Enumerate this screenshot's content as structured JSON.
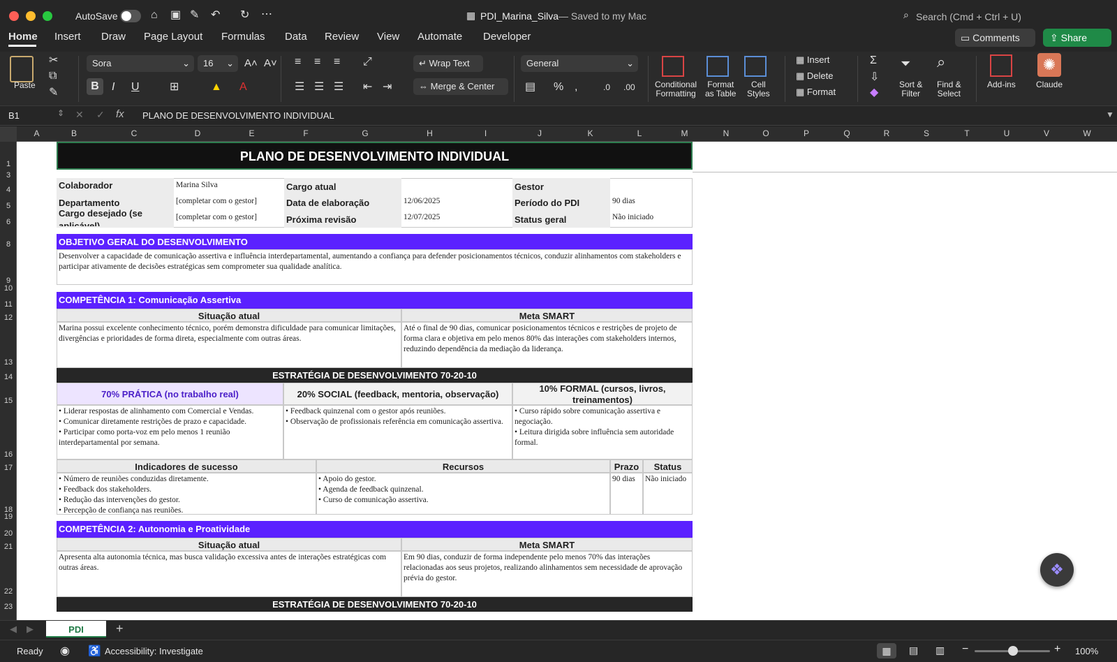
{
  "titlebar": {
    "autosave": "AutoSave",
    "doc_title": "PDI_Marina_Silva",
    "saved_status": "— Saved to my Mac",
    "search_placeholder": "Search (Cmd + Ctrl + U)"
  },
  "tabs": [
    "Home",
    "Insert",
    "Draw",
    "Page Layout",
    "Formulas",
    "Data",
    "Review",
    "View",
    "Automate",
    "Developer"
  ],
  "header_buttons": {
    "comments": "Comments",
    "share": "Share"
  },
  "ribbon": {
    "paste": "Paste",
    "font_name": "Sora",
    "font_size": "16",
    "wrap_text": "Wrap Text",
    "merge_center": "Merge & Center",
    "number_format": "General",
    "conditional": "Conditional",
    "formatting": "Formatting",
    "format_as": "Format",
    "as_table": "as Table",
    "cell": "Cell",
    "styles": "Styles",
    "insert": "Insert",
    "delete": "Delete",
    "format": "Format",
    "sort": "Sort &",
    "filter": "Filter",
    "find": "Find &",
    "select": "Select",
    "addins": "Add-ins",
    "claude": "Claude"
  },
  "formula_bar": {
    "cell_ref": "B1",
    "content": "PLANO DE DESENVOLVIMENTO INDIVIDUAL"
  },
  "columns": [
    "A",
    "B",
    "C",
    "D",
    "E",
    "F",
    "G",
    "H",
    "I",
    "J",
    "K",
    "L",
    "M",
    "N",
    "O",
    "P",
    "Q",
    "R",
    "S",
    "T",
    "U",
    "V",
    "W"
  ],
  "rows": [
    "1",
    "3",
    "4",
    "5",
    "6",
    "8",
    "9",
    "10",
    "11",
    "12",
    "13",
    "14",
    "15",
    "16",
    "17",
    "18",
    "19",
    "20",
    "21",
    "22",
    "23"
  ],
  "sheet": {
    "title": "PLANO DE DESENVOLVIMENTO INDIVIDUAL",
    "info": {
      "colaborador_label": "Colaborador",
      "colaborador": "Marina Silva",
      "cargo_label": "Cargo atual",
      "gestor_label": "Gestor",
      "departamento_label": "Departamento",
      "departamento": "[completar com o gestor]",
      "data_label": "Data de elaboração",
      "data": "12/06/2025",
      "periodo_label": "Período do PDI",
      "periodo": "90 dias",
      "cargo_desejado_label": "Cargo desejado (se aplicável)",
      "cargo_desejado": "[completar com o gestor]",
      "revisao_label": "Próxima revisão",
      "revisao": "12/07/2025",
      "status_label": "Status geral",
      "status": "Não iniciado"
    },
    "objetivo_title": "OBJETIVO GERAL DO DESENVOLVIMENTO",
    "objetivo_text": "Desenvolver a capacidade de comunicação assertiva e influência interdepartamental, aumentando a confiança para defender posicionamentos técnicos, conduzir alinhamentos com stakeholders e participar ativamente de decisões estratégicas sem comprometer sua qualidade analítica.",
    "comp1": {
      "title": "COMPETÊNCIA 1: Comunicação Assertiva",
      "situacao_label": "Situação atual",
      "meta_label": "Meta SMART",
      "situacao": "Marina possui excelente conhecimento técnico, porém demonstra dificuldade para comunicar limitações, divergências e prioridades de forma direta, especialmente com outras áreas.",
      "meta": "Até o final de 90 dias, comunicar posicionamentos técnicos e restrições de projeto de forma clara e objetiva em pelo menos 80% das interações com stakeholders internos, reduzindo dependência da mediação da liderança.",
      "estrategia": "ESTRATÉGIA DE DESENVOLVIMENTO 70-20-10",
      "pratica_label": "70% PRÁTICA (no trabalho real)",
      "social_label": "20% SOCIAL (feedback, mentoria, observação)",
      "formal_label": "10% FORMAL (cursos, livros, treinamentos)",
      "pratica": [
        "• Liderar respostas de alinhamento com Comercial e Vendas.",
        "• Comunicar diretamente restrições de prazo e capacidade.",
        "• Participar como porta-voz em pelo menos 1 reunião interdepartamental por semana."
      ],
      "social": [
        "• Feedback quinzenal com o gestor após reuniões.",
        "• Observação de profissionais referência em comunicação assertiva."
      ],
      "formal": [
        "• Curso rápido sobre comunicação assertiva e negociação.",
        "• Leitura dirigida sobre influência sem autoridade formal."
      ],
      "indicadores_label": "Indicadores de sucesso",
      "recursos_label": "Recursos",
      "prazo_label": "Prazo",
      "status_label": "Status",
      "indicadores": [
        "• Número de reuniões conduzidas diretamente.",
        "• Feedback dos stakeholders.",
        "• Redução das intervenções do gestor.",
        "• Percepção de confiança nas reuniões."
      ],
      "recursos": [
        "• Apoio do gestor.",
        "• Agenda de feedback quinzenal.",
        "• Curso de comunicação assertiva."
      ],
      "prazo": "90 dias",
      "status": "Não iniciado"
    },
    "comp2": {
      "title": "COMPETÊNCIA 2: Autonomia e Proatividade",
      "situacao_label": "Situação atual",
      "meta_label": "Meta SMART",
      "situacao": "Apresenta alta autonomia técnica, mas busca validação excessiva antes de interações estratégicas com outras áreas.",
      "meta": "Em 90 dias, conduzir de forma independente pelo menos 70% das interações relacionadas aos seus projetos, realizando alinhamentos sem necessidade de aprovação prévia do gestor.",
      "estrategia": "ESTRATÉGIA DE DESENVOLVIMENTO 70-20-10"
    }
  },
  "sheet_tab": "PDI",
  "status_bar": {
    "ready": "Ready",
    "accessibility": "Accessibility: Investigate",
    "zoom": "100%"
  }
}
